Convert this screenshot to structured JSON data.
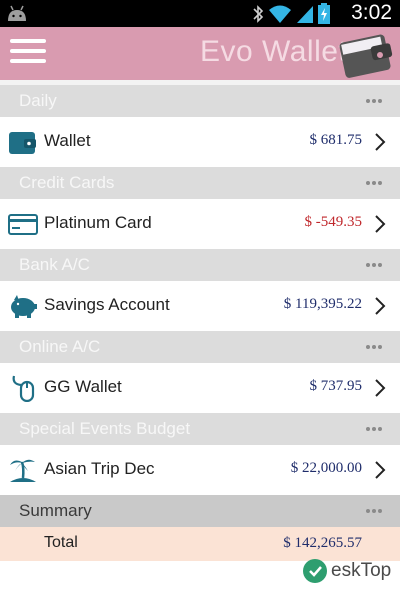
{
  "status_bar": {
    "time": "3:02"
  },
  "app_bar": {
    "title": "Evo  Wallet"
  },
  "sections": [
    {
      "header": "Daily",
      "item": {
        "name": "Wallet",
        "amount": "$ 681.75",
        "icon": "wallet-icon",
        "negative": false
      }
    },
    {
      "header": "Credit Cards",
      "item": {
        "name": "Platinum Card",
        "amount": "$ -549.35",
        "icon": "credit-card-icon",
        "negative": true
      }
    },
    {
      "header": "Bank A/C",
      "item": {
        "name": "Savings Account",
        "amount": "$ 119,395.22",
        "icon": "piggy-bank-icon",
        "negative": false
      }
    },
    {
      "header": "Online A/C",
      "item": {
        "name": "GG Wallet",
        "amount": "$ 737.95",
        "icon": "mouse-icon",
        "negative": false
      }
    },
    {
      "header": "Special Events Budget",
      "item": {
        "name": "Asian Trip Dec",
        "amount": "$ 22,000.00",
        "icon": "island-icon",
        "negative": false
      }
    }
  ],
  "summary": {
    "header": "Summary",
    "total_label": "Total",
    "total_amount": "$ 142,265.57"
  },
  "watermark": {
    "text": "eskTop"
  },
  "colors": {
    "app_bar": "#d99bb0",
    "section_header": "#dcdcdc",
    "summary_header": "#c9c9c9",
    "total_row": "#fbe3d5",
    "amount": "#1f2d6b",
    "negative_amount": "#c0282c",
    "icon_teal": "#1f6f86"
  }
}
